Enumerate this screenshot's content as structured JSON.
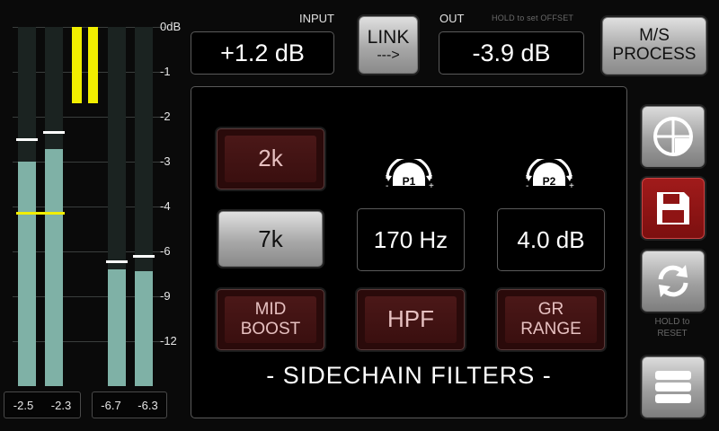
{
  "meters": {
    "scale": [
      "0dB",
      "-1",
      "-2",
      "-3",
      "-4",
      "-6",
      "-9",
      "-12"
    ],
    "channels": [
      {
        "level_fraction": 0.625,
        "peak_fraction": 0.685
      },
      {
        "level_fraction": 0.66,
        "peak_fraction": 0.705
      },
      {
        "level_fraction": 0.325,
        "peak_fraction": 0.345
      },
      {
        "level_fraction": 0.32,
        "peak_fraction": 0.36
      }
    ],
    "input_values": [
      "-2.5",
      "-2.3"
    ],
    "output_values": [
      "-6.7",
      "-6.3"
    ],
    "gain_reduction_color": "#f1ee00",
    "meter_color": "#7fb1a6"
  },
  "top": {
    "input_label": "INPUT",
    "input_value": "+1.2 dB",
    "link_label": "LINK",
    "link_arrow": "--->",
    "out_label": "OUT",
    "hold_offset_label": "HOLD to set OFFSET",
    "out_value": "-3.9 dB",
    "ms_label_1": "M/S",
    "ms_label_2": "PROCESS"
  },
  "panel": {
    "btn_2k": "2k",
    "btn_7k": "7k",
    "p1_label": "P1",
    "p2_label": "P2",
    "p1_value": "170 Hz",
    "p2_value": "4.0 dB",
    "mid_boost_1": "MID",
    "mid_boost_2": "BOOST",
    "hpf": "HPF",
    "gr_range_1": "GR",
    "gr_range_2": "RANGE",
    "title": "- SIDECHAIN FILTERS -"
  },
  "right": {
    "icons": [
      "quadrant-icon",
      "save-icon",
      "refresh-icon",
      "menu-icon"
    ],
    "hold_reset_1": "HOLD to",
    "hold_reset_2": "RESET",
    "save_color": "#8f1414"
  }
}
